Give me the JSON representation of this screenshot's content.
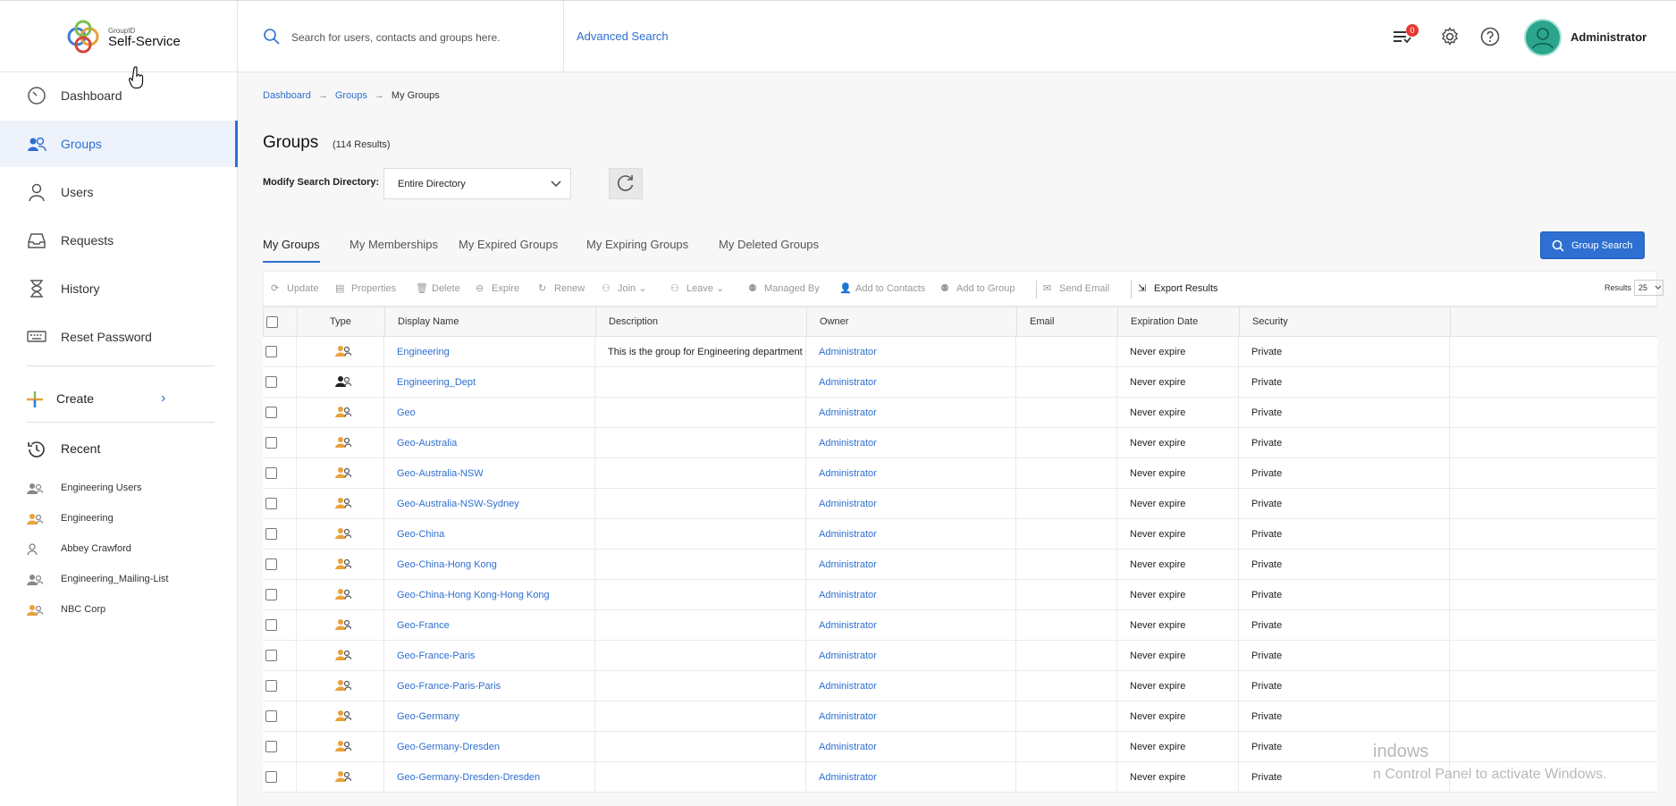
{
  "app": {
    "logo_small": "GroupID",
    "logo_name": "Self-Service"
  },
  "search": {
    "placeholder": "Search for users, contacts and groups here.",
    "advanced": "Advanced Search"
  },
  "header": {
    "notification_count": "0",
    "user_name": "Administrator"
  },
  "sidebar": {
    "items": [
      {
        "label": "Dashboard",
        "icon": "gauge-icon"
      },
      {
        "label": "Groups",
        "icon": "groups-icon",
        "active": true
      },
      {
        "label": "Users",
        "icon": "user-icon"
      },
      {
        "label": "Requests",
        "icon": "inbox-icon"
      },
      {
        "label": "History",
        "icon": "hourglass-icon"
      },
      {
        "label": "Reset Password",
        "icon": "keyboard-icon"
      }
    ],
    "create_label": "Create",
    "recent_title": "Recent",
    "recent": [
      {
        "label": "Engineering Users",
        "icon": "group-gray-icon"
      },
      {
        "label": "Engineering",
        "icon": "group-orange-icon"
      },
      {
        "label": "Abbey Crawford",
        "icon": "user-icon"
      },
      {
        "label": "Engineering_Mailing-List",
        "icon": "group-gray-icon"
      },
      {
        "label": "NBC Corp",
        "icon": "group-orange-icon"
      }
    ]
  },
  "breadcrumb": [
    "Dashboard",
    "Groups",
    "My Groups"
  ],
  "page": {
    "title": "Groups",
    "result_count": "(114 Results)",
    "modify_label": "Modify Search Directory:",
    "directory_value": "Entire Directory"
  },
  "tabs": [
    "My Groups",
    "My Memberships",
    "My Expired Groups",
    "My Expiring Groups",
    "My Deleted Groups"
  ],
  "group_search_label": "Group Search",
  "toolbar": {
    "update": "Update",
    "properties": "Properties",
    "delete": "Delete",
    "expire": "Expire",
    "renew": "Renew",
    "join": "Join",
    "leave": "Leave",
    "managed_by": "Managed By",
    "add_to_contacts": "Add to Contacts",
    "add_to_group": "Add to Group",
    "send_email": "Send Email",
    "export_results": "Export Results",
    "results_label": "Results",
    "results_value": "25"
  },
  "table": {
    "columns": [
      "Type",
      "Display Name",
      "Description",
      "Owner",
      "Email",
      "Expiration Date",
      "Security"
    ],
    "rows": [
      {
        "name": "Engineering",
        "description": "This is the group for Engineering department",
        "owner": "Administrator",
        "email": "",
        "expiration": "Never expire",
        "security": "Private",
        "type": "orange"
      },
      {
        "name": "Engineering_Dept",
        "description": "",
        "owner": "Administrator",
        "email": "",
        "expiration": "Never expire",
        "security": "Private",
        "type": "dark"
      },
      {
        "name": "Geo",
        "description": "",
        "owner": "Administrator",
        "email": "",
        "expiration": "Never expire",
        "security": "Private",
        "type": "orange"
      },
      {
        "name": "Geo-Australia",
        "description": "",
        "owner": "Administrator",
        "email": "",
        "expiration": "Never expire",
        "security": "Private",
        "type": "orange"
      },
      {
        "name": "Geo-Australia-NSW",
        "description": "",
        "owner": "Administrator",
        "email": "",
        "expiration": "Never expire",
        "security": "Private",
        "type": "orange"
      },
      {
        "name": "Geo-Australia-NSW-Sydney",
        "description": "",
        "owner": "Administrator",
        "email": "",
        "expiration": "Never expire",
        "security": "Private",
        "type": "orange"
      },
      {
        "name": "Geo-China",
        "description": "",
        "owner": "Administrator",
        "email": "",
        "expiration": "Never expire",
        "security": "Private",
        "type": "orange"
      },
      {
        "name": "Geo-China-Hong Kong",
        "description": "",
        "owner": "Administrator",
        "email": "",
        "expiration": "Never expire",
        "security": "Private",
        "type": "orange"
      },
      {
        "name": "Geo-China-Hong Kong-Hong Kong",
        "description": "",
        "owner": "Administrator",
        "email": "",
        "expiration": "Never expire",
        "security": "Private",
        "type": "orange"
      },
      {
        "name": "Geo-France",
        "description": "",
        "owner": "Administrator",
        "email": "",
        "expiration": "Never expire",
        "security": "Private",
        "type": "orange"
      },
      {
        "name": "Geo-France-Paris",
        "description": "",
        "owner": "Administrator",
        "email": "",
        "expiration": "Never expire",
        "security": "Private",
        "type": "orange"
      },
      {
        "name": "Geo-France-Paris-Paris",
        "description": "",
        "owner": "Administrator",
        "email": "",
        "expiration": "Never expire",
        "security": "Private",
        "type": "orange"
      },
      {
        "name": "Geo-Germany",
        "description": "",
        "owner": "Administrator",
        "email": "",
        "expiration": "Never expire",
        "security": "Private",
        "type": "orange"
      },
      {
        "name": "Geo-Germany-Dresden",
        "description": "",
        "owner": "Administrator",
        "email": "",
        "expiration": "Never expire",
        "security": "Private",
        "type": "orange"
      },
      {
        "name": "Geo-Germany-Dresden-Dresden",
        "description": "",
        "owner": "Administrator",
        "email": "",
        "expiration": "Never expire",
        "security": "Private",
        "type": "orange"
      }
    ]
  },
  "watermark": {
    "line1": "indows",
    "line2": "n Control Panel to activate Windows."
  },
  "colors": {
    "accent": "#2e6fd1",
    "group_orange": "#e8a23a",
    "avatar": "#2ca58d",
    "badge": "#e53935"
  }
}
